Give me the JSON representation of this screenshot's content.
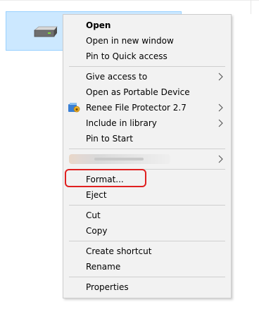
{
  "menu": {
    "items": {
      "open": "Open",
      "open_new_window": "Open in new window",
      "pin_quick_access": "Pin to Quick access",
      "give_access": "Give access to",
      "open_portable": "Open as Portable Device",
      "renee": "Renee File Protector 2.7",
      "include_library": "Include in library",
      "pin_start": "Pin to Start",
      "format": "Format...",
      "eject": "Eject",
      "cut": "Cut",
      "copy": "Copy",
      "create_shortcut": "Create shortcut",
      "rename": "Rename",
      "properties": "Properties"
    }
  },
  "icons": {
    "drive": "hard-drive-icon",
    "renee": "renee-file-protector-icon",
    "submenu": "chevron-right-icon"
  },
  "colors": {
    "selection_bg": "#cce8ff",
    "selection_border": "#99d1ff",
    "menu_bg": "#f2f2f2",
    "highlight_outline": "#e02020"
  }
}
